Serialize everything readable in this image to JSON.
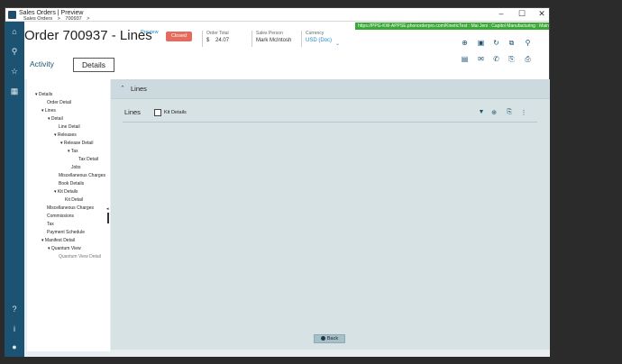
{
  "window": {
    "title": "Sales Orders | Preview",
    "url_bar": "https://PPG-KW-APPSE.phonorderpro.com/KineticTest : Mai Jeni : Capitol Manufacturing : Main Pl"
  },
  "breadcrumb": [
    "Sales Orders",
    ">",
    "700937",
    ">"
  ],
  "header": {
    "title": "Order 700937 - Lines",
    "preview": "Preview",
    "status": "Closed",
    "order_total_label": "Order Total",
    "order_total_currency": "$",
    "order_total_value": "24.07",
    "sales_person_label": "Sales Person",
    "sales_person_value": "Mark McIntosh",
    "currency_label": "Currency",
    "currency_value": "USD (Doc)"
  },
  "tabs": {
    "activity": "Activity",
    "details": "Details"
  },
  "tree": [
    {
      "label": "Details",
      "expanded": true
    },
    {
      "label": "Order Detail"
    },
    {
      "label": "Lines",
      "expanded": true
    },
    {
      "label": "Detail",
      "expanded": true
    },
    {
      "label": "Line Detail"
    },
    {
      "label": "Releases",
      "expanded": true
    },
    {
      "label": "Release Detail",
      "expanded": true
    },
    {
      "label": "Tax",
      "expanded": true
    },
    {
      "label": "Tax Detail"
    },
    {
      "label": "Jobs"
    },
    {
      "label": "Miscellaneous Charges"
    },
    {
      "label": "Book Details"
    },
    {
      "label": "Kit Details",
      "expanded": true
    },
    {
      "label": "Kit Detail"
    },
    {
      "label": "Miscellaneous Charges"
    },
    {
      "label": "Commissions"
    },
    {
      "label": "Tax"
    },
    {
      "label": "Payment Schedule"
    },
    {
      "label": "Manifest Detail",
      "expanded": true
    },
    {
      "label": "Quantum View",
      "expanded": true
    },
    {
      "label": "Quantum View Detail"
    }
  ],
  "lines_panel": {
    "section_title": "Lines",
    "grid_title": "Lines",
    "kit_details_label": "Kit Details"
  },
  "footer": {
    "back_label": "Back"
  },
  "colors": {
    "sidebar": "#1d5372",
    "accent": "#1e88c7",
    "closed": "#e46b5e",
    "url_bar": "#3aa935"
  }
}
